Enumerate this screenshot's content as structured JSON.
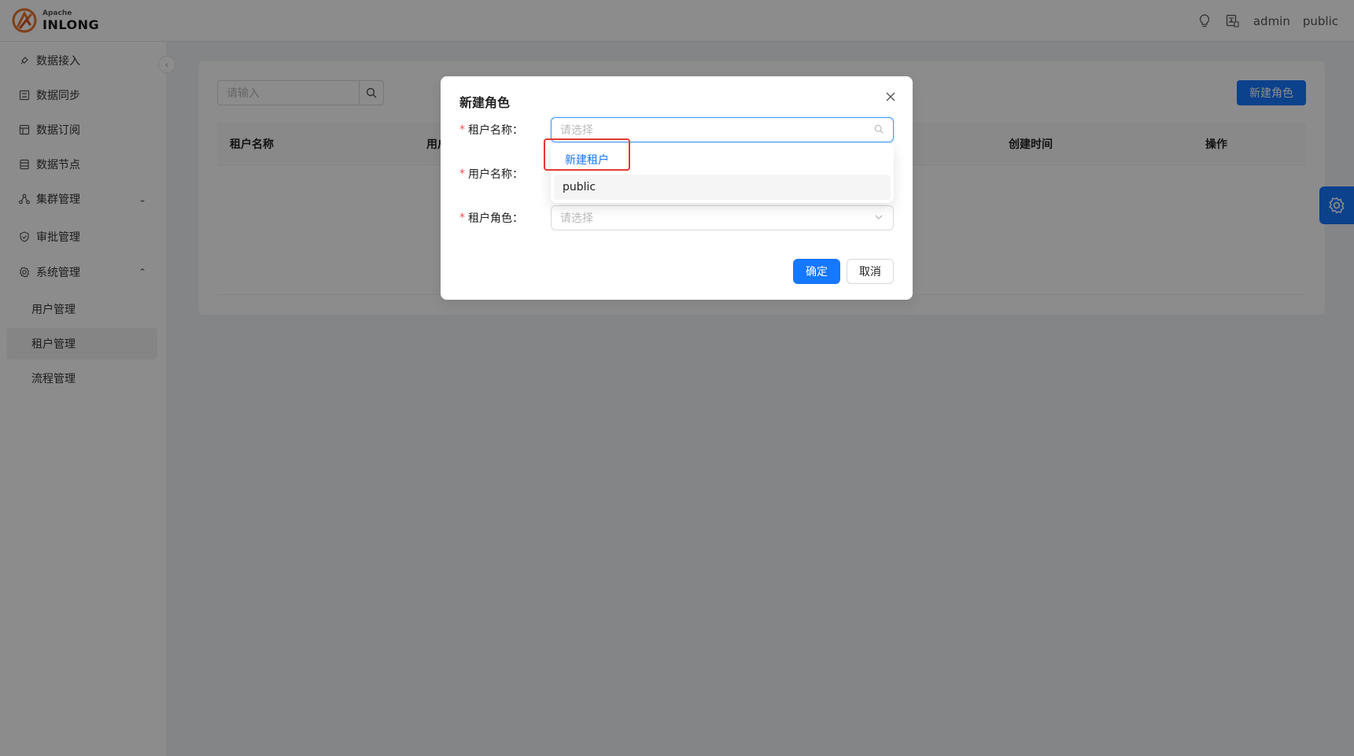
{
  "header": {
    "logo_small": "Apache",
    "logo_big": "INLONG",
    "user": "admin",
    "tenant": "public"
  },
  "sidebar": {
    "items": [
      {
        "label": "数据接入",
        "icon": "data-access-icon"
      },
      {
        "label": "数据同步",
        "icon": "data-sync-icon"
      },
      {
        "label": "数据订阅",
        "icon": "data-subscribe-icon"
      },
      {
        "label": "数据节点",
        "icon": "data-node-icon"
      },
      {
        "label": "集群管理",
        "icon": "cluster-icon"
      },
      {
        "label": "审批管理",
        "icon": "approval-icon"
      },
      {
        "label": "系统管理",
        "icon": "gear-icon"
      }
    ],
    "sub_items": [
      {
        "label": "用户管理"
      },
      {
        "label": "租户管理"
      },
      {
        "label": "流程管理"
      }
    ]
  },
  "main": {
    "search_placeholder": "请输入",
    "new_role_label": "新建角色",
    "columns": [
      "租户名称",
      "用户",
      "创建时间",
      "操作"
    ]
  },
  "modal": {
    "title": "新建角色",
    "fields": [
      {
        "label": "租户名称：",
        "placeholder": "请选择"
      },
      {
        "label": "用户名称：",
        "placeholder": ""
      },
      {
        "label": "租户角色：",
        "placeholder": "请选择"
      }
    ],
    "ok_label": "确定",
    "cancel_label": "取消"
  },
  "dropdown": {
    "new_tenant_label": "新建租户",
    "options": [
      "public"
    ]
  },
  "colors": {
    "primary": "#1677ff",
    "highlight": "#e53935"
  }
}
